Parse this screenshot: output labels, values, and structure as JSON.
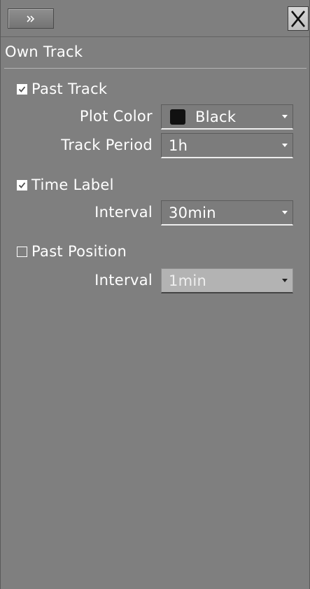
{
  "window": {
    "title": "Own Track"
  },
  "past_track": {
    "label": "Past Track",
    "checked": true,
    "plot_color": {
      "label": "Plot Color",
      "value": "Black",
      "swatch_color": "#111111"
    },
    "track_period": {
      "label": "Track Period",
      "value": "1h"
    }
  },
  "time_label": {
    "label": "Time Label",
    "checked": true,
    "interval": {
      "label": "Interval",
      "value": "30min"
    }
  },
  "past_position": {
    "label": "Past Position",
    "checked": false,
    "interval": {
      "label": "Interval",
      "value": "1min",
      "disabled": true
    }
  },
  "icons": {
    "expand": "double-chevron-right-icon",
    "close": "close-icon",
    "check": "checkmark-icon",
    "dropdown": "caret-down-icon"
  }
}
